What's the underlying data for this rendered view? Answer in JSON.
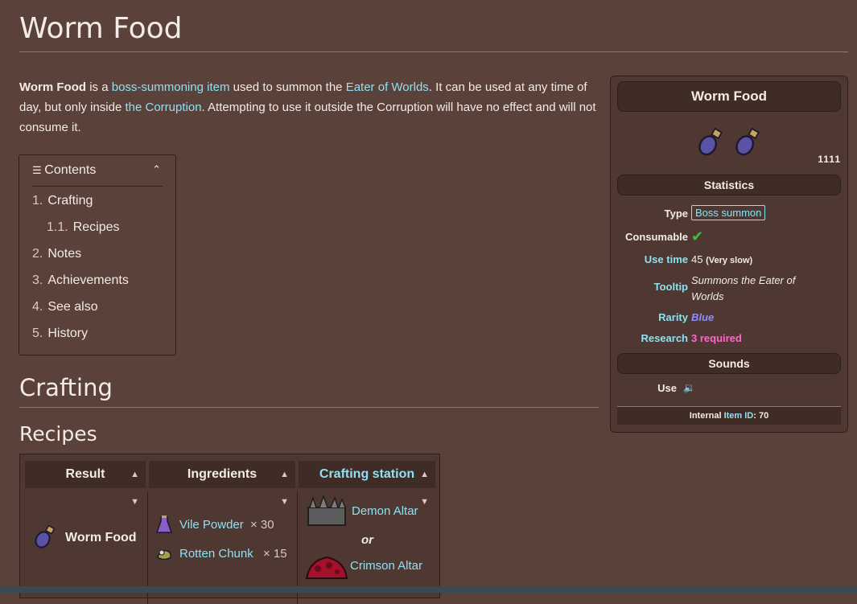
{
  "page": {
    "title": "Worm Food",
    "intro": {
      "subject": "Worm Food",
      "t1": " is a ",
      "link1": "boss-summoning item",
      "t2": " used to summon the ",
      "link2": "Eater of Worlds",
      "t3": ". It can be used at any time of day, but only inside ",
      "link3": "the Corruption",
      "t4": ". Attempting to use it outside the Corruption will have no effect and will not consume it."
    }
  },
  "toc": {
    "label": "Contents",
    "items": [
      {
        "num": "1.",
        "label": "Crafting"
      },
      {
        "num": "1.1.",
        "label": "Recipes"
      },
      {
        "num": "2.",
        "label": "Notes"
      },
      {
        "num": "3.",
        "label": "Achievements"
      },
      {
        "num": "4.",
        "label": "See also"
      },
      {
        "num": "5.",
        "label": "History"
      }
    ]
  },
  "sections": {
    "crafting": "Crafting",
    "recipes": "Recipes"
  },
  "recipes_table": {
    "headers": [
      "Result",
      "Ingredients",
      "Crafting station"
    ],
    "result": "Worm Food",
    "ingredients": [
      {
        "name": "Vile Powder",
        "qty": "× 30"
      },
      {
        "name": "Rotten Chunk",
        "qty": "× 15"
      }
    ],
    "stations": [
      "Demon Altar",
      "or",
      "Crimson Altar"
    ]
  },
  "infobox": {
    "title": "Worm Food",
    "modes_badge": "1111",
    "statistics_label": "Statistics",
    "type_key": "Type",
    "type_value": "Boss summon",
    "consumable_key": "Consumable",
    "consumable_value": "✔",
    "use_time_key": "Use time",
    "use_time_value": "45",
    "use_time_note": "(Very slow)",
    "tooltip_key": "Tooltip",
    "tooltip_value": "Summons the Eater of Worlds",
    "rarity_key": "Rarity",
    "rarity_value": "Blue",
    "research_key": "Research",
    "research_value": "3 required",
    "sounds_label": "Sounds",
    "use_key": "Use",
    "footer_a": "Internal ",
    "footer_link": "Item ID",
    "footer_b": ": 70"
  },
  "colors": {
    "background": "#5a4139",
    "link": "#8fe0f2",
    "research": "#ff66cc",
    "rarity": "#8f8fff"
  }
}
